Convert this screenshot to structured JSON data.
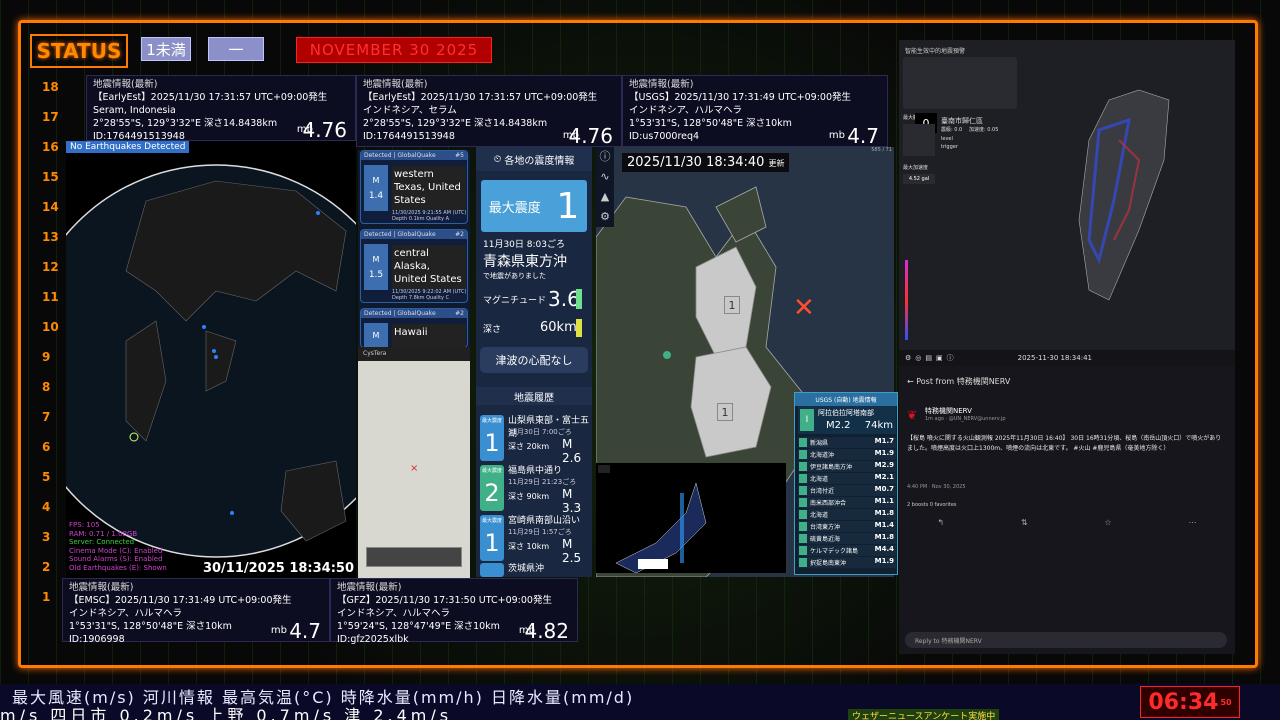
{
  "header": {
    "status_label": "STATUS",
    "pill1": "1未満",
    "pill2": "一",
    "date": "NOVEMBER 30 2025"
  },
  "scale": [
    "18",
    "17",
    "16",
    "15",
    "14",
    "13",
    "12",
    "11",
    "10",
    "9",
    "8",
    "7",
    "6",
    "5",
    "4",
    "3",
    "2",
    "1"
  ],
  "quakes": [
    {
      "hdr": "地震情報(最新)",
      "src": "【EarlyEst】2025/11/30 17:31:57 UTC+09:00発生",
      "place": "Seram, Indonesia",
      "coord": "2°28'55\"S, 129°3'32\"E 深さ14.8438km",
      "id": "ID:1764491513948",
      "mb": "mb",
      "mag": "4.76"
    },
    {
      "hdr": "地震情報(最新)",
      "src": "【EarlyEst】2025/11/30 17:31:57 UTC+09:00発生",
      "place": "インドネシア、セラム",
      "coord": "2°28'55\"S, 129°3'32\"E 深さ14.8438km",
      "id": "ID:1764491513948",
      "mb": "mb",
      "mag": "4.76"
    },
    {
      "hdr": "地震情報(最新)",
      "src": "【USGS】2025/11/30 17:31:49 UTC+09:00発生",
      "place": "インドネシア、ハルマヘラ",
      "coord": "1°53'31\"S, 128°50'48\"E 深さ10km",
      "id": "ID:us7000req4",
      "mb": "mb",
      "mag": "4.7"
    },
    {
      "hdr": "地震情報(最新)",
      "src": "【EMSC】2025/11/30 17:31:49 UTC+09:00発生",
      "place": "インドネシア、ハルマヘラ",
      "coord": "1°53'31\"S, 128°50'48\"E 深さ10km",
      "id": "ID:1906998",
      "mb": "mb",
      "mag": "4.7"
    },
    {
      "hdr": "地震情報(最新)",
      "src": "【GFZ】2025/11/30 17:31:50 UTC+09:00発生",
      "place": "インドネシア、ハルマヘラ",
      "coord": "1°59'24\"S, 128°47'49\"E 深さ10km",
      "id": "ID:gfz2025xlbk",
      "mb": "mb",
      "mag": "4.82"
    }
  ],
  "globe": {
    "banner": "No Earthquakes Detected",
    "timestamp": "30/11/2025 18:34:50",
    "stats": [
      "FPS: 105",
      "RAM: 0.71 / 1.08GB",
      "Server: Connected",
      "Cinema Mode (C): Enabled",
      "Sound Alarms (S): Enabled",
      "Old Earthquakes (E): Shown"
    ]
  },
  "globalquake": [
    {
      "top": "Detected | GlobalQuake",
      "no": "#5",
      "m": "M",
      "mag": "1.4",
      "place": "western Texas, United States",
      "meta1": "11/30/2025 9:21:55 AM (UTC)",
      "meta2": "Depth 0.1km   Quality A"
    },
    {
      "top": "Detected | GlobalQuake",
      "no": "#2",
      "m": "M",
      "mag": "1.5",
      "place": "central Alaska, United States",
      "meta1": "11/30/2025 9:22:02 AM (UTC)",
      "meta2": "Depth 7.8km   Quality C"
    },
    {
      "top": "Detected | GlobalQuake",
      "no": "#2",
      "m": "M",
      "mag": "",
      "place": "Hawaii",
      "meta1": "",
      "meta2": ""
    }
  ],
  "small_map": {
    "title": "CysTera"
  },
  "info": {
    "head": "各地の震度情報",
    "max_label": "最大震度",
    "max_value": "1",
    "time": "11月30日 8:03ごろ",
    "region": "青森県東方沖",
    "note": "で地震がありました",
    "mag_label": "マグニチュード",
    "mag_value": "3.6",
    "depth_label": "深さ",
    "depth_value": "60km",
    "tsunami": "津波の心配なし",
    "history_head": "地震履歴",
    "history": [
      {
        "lbl": "最大震度",
        "num": "1",
        "place": "山梨県東部・富士五湖",
        "date": "11月30日 7:00ごろ",
        "depth": "深さ 20km",
        "m": "M 2.6",
        "color": "#3a8fd0"
      },
      {
        "lbl": "最大震度",
        "num": "2",
        "place": "福島県中通り",
        "date": "11月29日 21:23ごろ",
        "depth": "深さ 90km",
        "m": "M 3.3",
        "color": "#3fb088"
      },
      {
        "lbl": "最大震度",
        "num": "1",
        "place": "宮崎県南部山沿い",
        "date": "11月29日 1:57ごろ",
        "depth": "深さ 10km",
        "m": "M 2.5",
        "color": "#3a8fd0"
      },
      {
        "lbl": "",
        "num": "",
        "place": "茨城県沖",
        "date": "",
        "depth": "",
        "m": "",
        "color": "#3a8fd0"
      }
    ]
  },
  "jp_map": {
    "time": "2025/11/30 18:34:40",
    "update": "更新",
    "label1": "1",
    "label2": "1",
    "corner": "585 / 71"
  },
  "usgs": {
    "head": "USGS (自動) 地震情報",
    "feat_no": "I",
    "feat_place": "阿拉伯拉阿塔南部",
    "feat_mag": "M2.2",
    "feat_depth": "74km",
    "rows": [
      {
        "place": "新潟県",
        "m": "M1.7"
      },
      {
        "place": "北海道沖",
        "m": "M1.9"
      },
      {
        "place": "伊豆諸島南方沖",
        "m": "M2.9"
      },
      {
        "place": "北海道",
        "m": "M2.1"
      },
      {
        "place": "台湾付近",
        "m": "M0.7"
      },
      {
        "place": "南米西部沖合",
        "m": "M1.1"
      },
      {
        "place": "北海道",
        "m": "M1.8"
      },
      {
        "place": "台湾東方沖",
        "m": "M1.4"
      },
      {
        "place": "硫黄島近海",
        "m": "M1.8"
      },
      {
        "place": "ケルマデック諸島",
        "m": "M4.4"
      },
      {
        "place": "択捉島南東沖",
        "m": "M1.9"
      }
    ]
  },
  "taiwan": {
    "title": "智能生效中的地震預警",
    "pin": "0",
    "city": "臺南市歸仁區",
    "level": "震級: 0.0",
    "accel": "加速度: 0.05",
    "lbl1": "最大觀測震度",
    "lbl2": "最大加速度",
    "lvl": "level",
    "trg": "trigger",
    "gal": "4.52 gal",
    "time": "2025-11-30 18:34:41"
  },
  "post": {
    "title": "Post from 特務機関NERV",
    "user": "特務機関NERV",
    "handle": "1m ago · @UN_NERV@unnerv.jp",
    "body": "【桜島 噴火に関する火山観測報 2025年11月30日 16:40】 30日 16時31分頃、桜島（南岳山頂火口）で噴火がありました。噴煙高度は火口上1300m、噴煙の流向は北東です。 #火山 #鹿児島県（奄美地方除く）",
    "date": "4:40 PM · Nov 30, 2025",
    "stats": "2 boosts  0 favorites",
    "reply": "Reply to 特務機関NERV"
  },
  "ticker": {
    "line1": "最大風速(m/s)  河川情報      最高気温(°C)   時降水量(mm/h)   日降水量(mm/d)",
    "line2": "m/s     四日市 0.2m/s     上野 0.7m/s     津 2.4m/s",
    "news": "ウェザーニュースアンケート実施中"
  },
  "clock": {
    "time": "06:34",
    "sec": "50"
  }
}
